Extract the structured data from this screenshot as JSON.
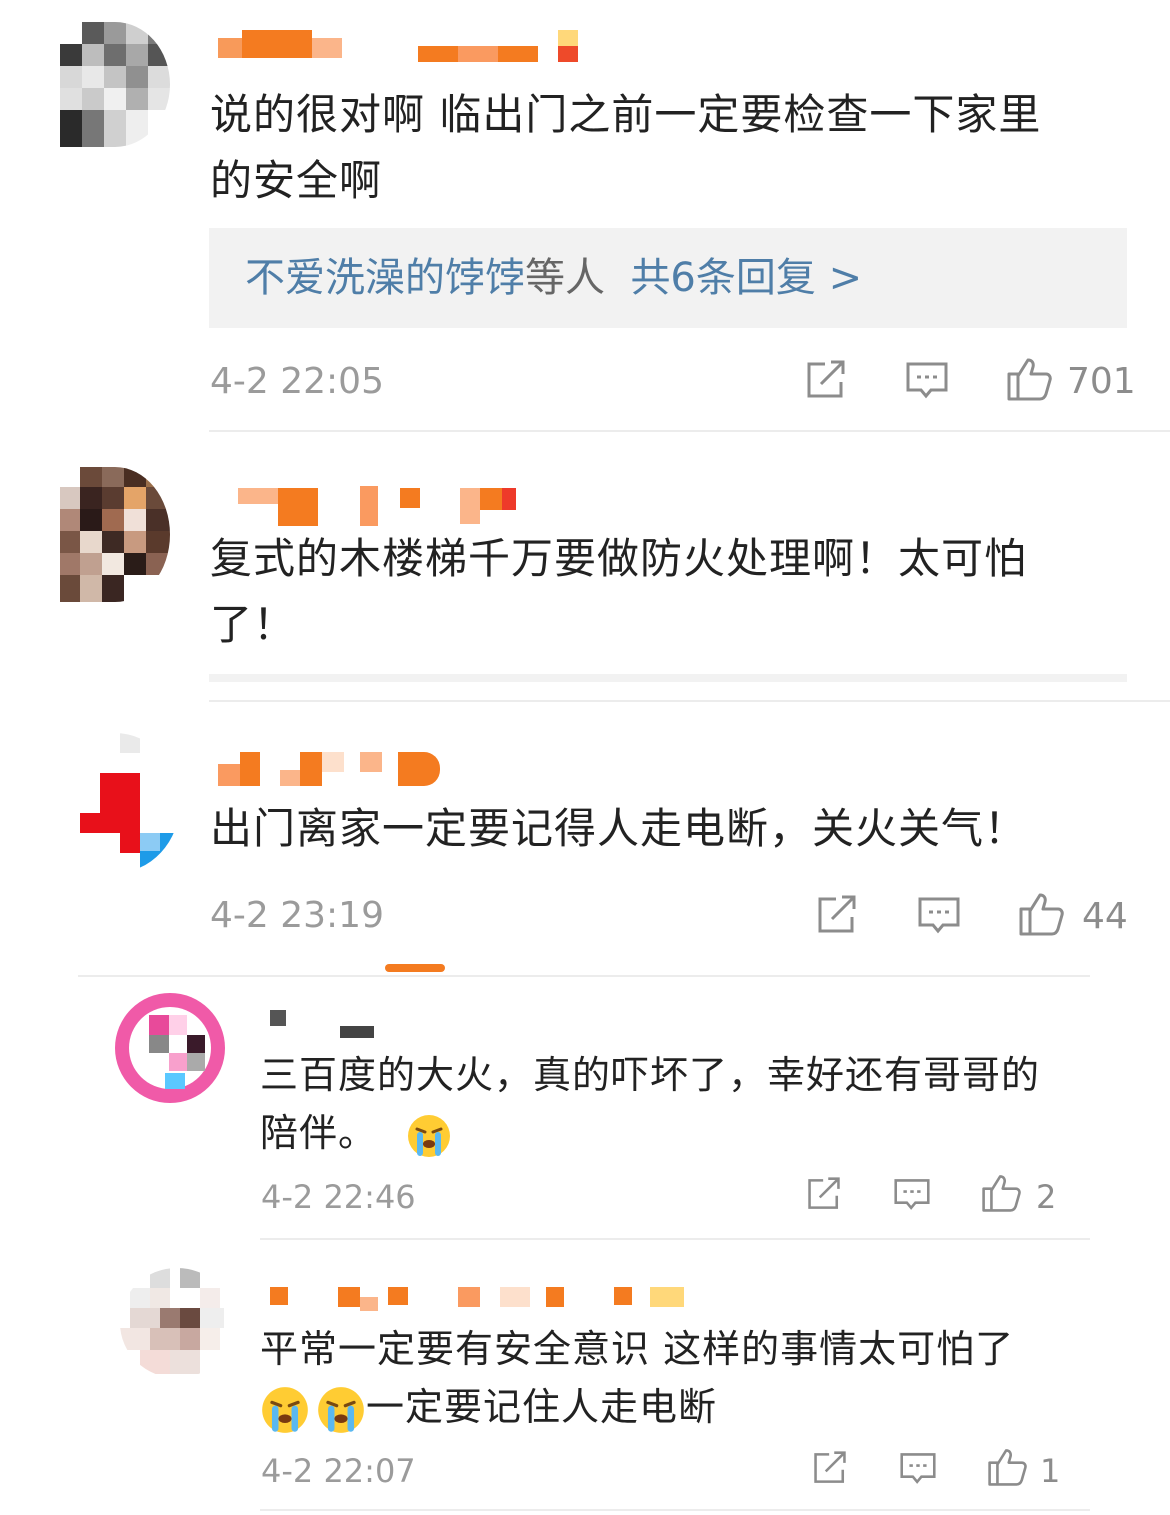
{
  "comments": [
    {
      "text_line1": "说的很对啊 临出门之前一定要检查一下家里",
      "text_line2": "的安全啊",
      "reply_summary": {
        "names": "不爱洗澡的饽饽",
        "suffix": "等人",
        "count_link": "共6条回复 >"
      },
      "time": "4-2 22:05",
      "likes": "701"
    },
    {
      "text_line1": "复式的木楼梯千万要做防火处理啊！太可怕",
      "text_line2": "了！"
    },
    {
      "text_line1": "出门离家一定要记得人走电断，关火关气！",
      "time": "4-2 23:19",
      "likes": "44"
    },
    {
      "text_line1": "三百度的大火，真的吓坏了，幸好还有哥哥的",
      "text_line2": "陪伴。",
      "emoji": "crying-face-icon",
      "time": "4-2 22:46",
      "likes": "2"
    },
    {
      "text_line1": "平常一定要有安全意识 这样的事情太可怕了",
      "text_line2": "一定要记住人走电断",
      "emoji": "crying-face-icon",
      "time": "4-2 22:07",
      "likes": "1"
    }
  ],
  "icons": {
    "share": "share-icon",
    "comment": "comment-icon",
    "like": "thumbs-up-icon"
  },
  "colors": {
    "link": "#4f7ea8",
    "meta": "#9b9b9b",
    "name_blur": "#f47b20"
  }
}
